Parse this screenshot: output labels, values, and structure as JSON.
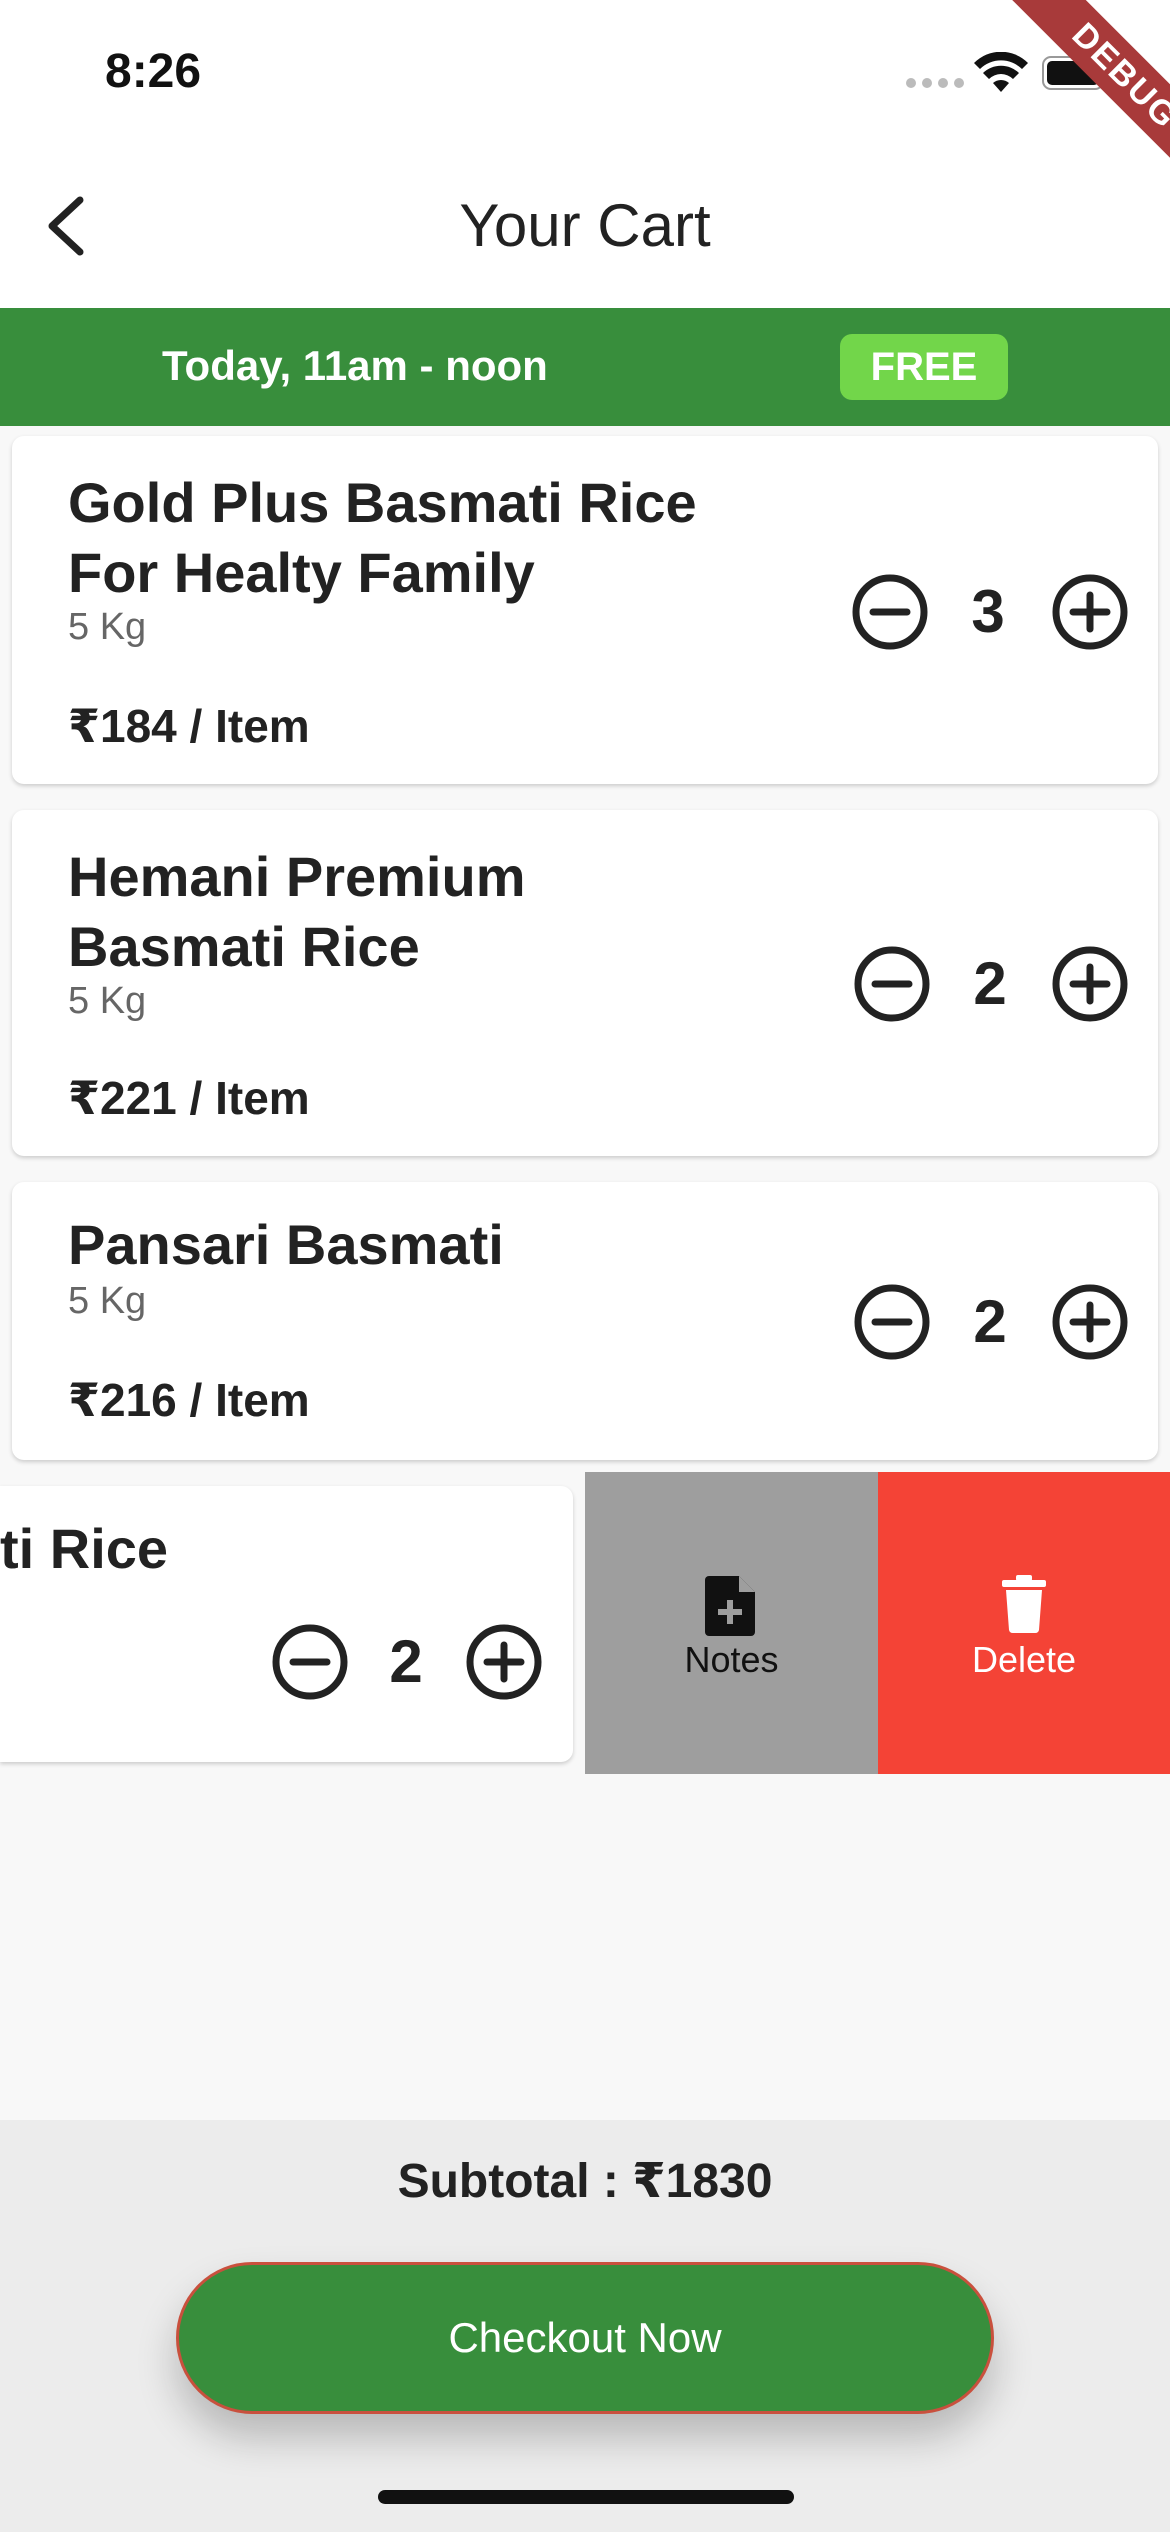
{
  "status_bar": {
    "time": "8:26"
  },
  "debug_banner": "DEBUG",
  "header": {
    "title": "Your Cart"
  },
  "delivery": {
    "slot": "Today, 11am - noon",
    "fee_badge": "FREE"
  },
  "cart_items": [
    {
      "name": "Gold Plus Basmati Rice For Healty Family",
      "weight": "5 Kg",
      "price": "₹184 / Item",
      "quantity": "3"
    },
    {
      "name": "Hemani Premium Basmati Rice",
      "weight": "5 Kg",
      "price": "₹221 / Item",
      "quantity": "2"
    },
    {
      "name": "Pansari Basmati",
      "weight": "5 Kg",
      "price": "₹216 / Item",
      "quantity": "2"
    },
    {
      "name_visible_fragment": "ti Rice",
      "quantity": "2"
    }
  ],
  "swipe_actions": {
    "notes_label": "Notes",
    "delete_label": "Delete"
  },
  "footer": {
    "subtotal": "Subtotal : ₹1830",
    "checkout_label": "Checkout Now"
  },
  "colors": {
    "primary_green": "#388e3c",
    "free_badge": "#72d64a",
    "delete_red": "#f44336",
    "notes_grey": "#9e9e9e"
  },
  "icons": [
    "back-arrow-icon",
    "minus-circle-icon",
    "plus-circle-icon",
    "note-add-icon",
    "trash-icon",
    "wifi-icon",
    "battery-icon"
  ]
}
